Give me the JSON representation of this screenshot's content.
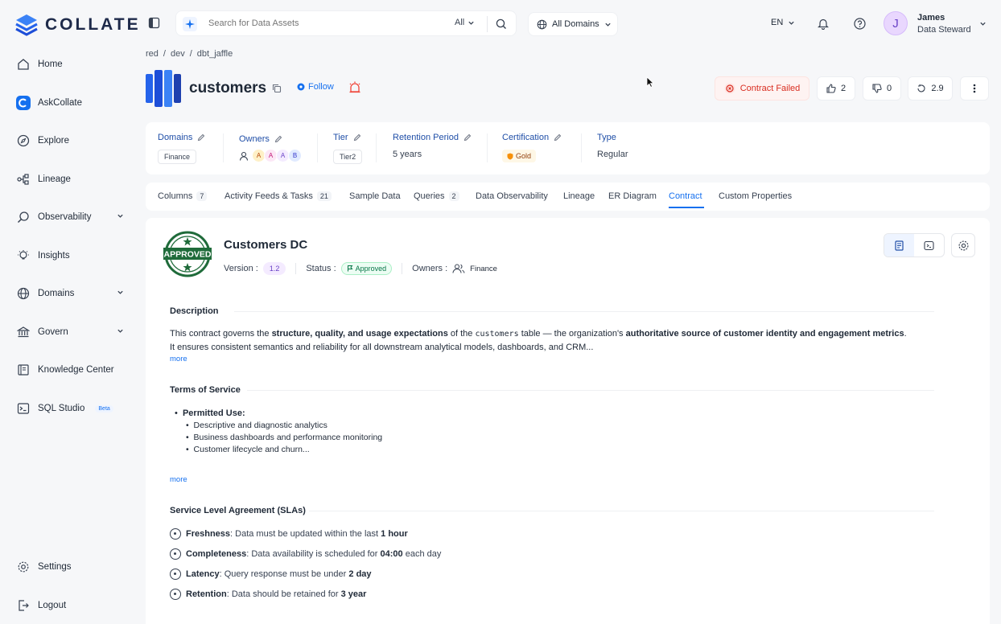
{
  "app": {
    "logo_text": "COLLATE"
  },
  "sidebar": {
    "items": [
      {
        "label": "Home"
      },
      {
        "label": "AskCollate"
      },
      {
        "label": "Explore"
      },
      {
        "label": "Lineage"
      },
      {
        "label": "Observability"
      },
      {
        "label": "Insights"
      },
      {
        "label": "Domains"
      },
      {
        "label": "Govern"
      },
      {
        "label": "Knowledge Center"
      },
      {
        "label": "SQL Studio",
        "badge": "Beta"
      },
      {
        "label": "Settings"
      },
      {
        "label": "Logout"
      }
    ]
  },
  "topbar": {
    "search_placeholder": "Search for Data Assets",
    "search_scope": "All",
    "domain_selector": "All Domains",
    "language": "EN",
    "user": {
      "initial": "J",
      "name": "James",
      "role": "Data Steward"
    }
  },
  "breadcrumb": [
    "red",
    "dev",
    "dbt_jaffle"
  ],
  "entity": {
    "name": "customers",
    "follow_label": "Follow",
    "actions": {
      "contract_status": "Contract Failed",
      "upvotes": "2",
      "downvotes": "0",
      "version": "2.9"
    }
  },
  "metadata": {
    "domains": {
      "label": "Domains",
      "value": "Finance"
    },
    "owners": {
      "label": "Owners",
      "avatars": [
        "A",
        "A",
        "A",
        "B"
      ]
    },
    "tier": {
      "label": "Tier",
      "value": "Tier2"
    },
    "retention": {
      "label": "Retention Period",
      "value": "5 years"
    },
    "certification": {
      "label": "Certification",
      "value": "Gold"
    },
    "type": {
      "label": "Type",
      "value": "Regular"
    }
  },
  "tabs": [
    {
      "label": "Columns",
      "count": "7"
    },
    {
      "label": "Activity Feeds & Tasks",
      "count": "21"
    },
    {
      "label": "Sample Data",
      "count": ""
    },
    {
      "label": "Queries",
      "count": "2"
    },
    {
      "label": "Data Observability",
      "count": ""
    },
    {
      "label": "Lineage",
      "count": ""
    },
    {
      "label": "ER Diagram",
      "count": ""
    },
    {
      "label": "Contract",
      "count": "",
      "active": true
    },
    {
      "label": "Custom Properties",
      "count": ""
    }
  ],
  "contract": {
    "seal_text": "APPROVED",
    "title": "Customers DC",
    "version_label": "Version :",
    "version": "1.2",
    "status_label": "Status :",
    "status": "Approved",
    "owners_label": "Owners :",
    "owner": "Finance",
    "description": {
      "heading": "Description",
      "l1_a": "This contract governs the ",
      "l1_b": "structure, quality, and usage expectations",
      "l1_c": " of the ",
      "l1_code": "customers",
      "l1_d": " table — the organization's ",
      "l1_e": "authoritative source of customer identity and engagement metrics",
      "l1_f": ".",
      "l2": "It ensures consistent semantics and reliability for all downstream analytical models, dashboards, and CRM...",
      "more": "more"
    },
    "terms": {
      "heading": "Terms of Service",
      "permitted": "Permitted Use",
      "items": [
        "Descriptive and diagnostic analytics",
        "Business dashboards and performance monitoring",
        "Customer lifecycle and churn..."
      ],
      "more": "more"
    },
    "sla": {
      "heading": "Service Level Agreement (SLAs)",
      "items": [
        {
          "name": "Freshness",
          "text": ": Data must be updated within the last ",
          "value": "1 hour",
          "suffix": ""
        },
        {
          "name": "Completeness",
          "text": ": Data availability is scheduled for ",
          "value": "04:00",
          "suffix": " each day"
        },
        {
          "name": "Latency",
          "text": ": Query response must be under ",
          "value": "2 day",
          "suffix": ""
        },
        {
          "name": "Retention",
          "text": ": Data should be retained for ",
          "value": "3 year",
          "suffix": ""
        }
      ]
    }
  },
  "colors": {
    "accent": "#1570ef",
    "danger": "#d92d20",
    "success": "#067647",
    "seal_green": "#1f6b3a"
  }
}
